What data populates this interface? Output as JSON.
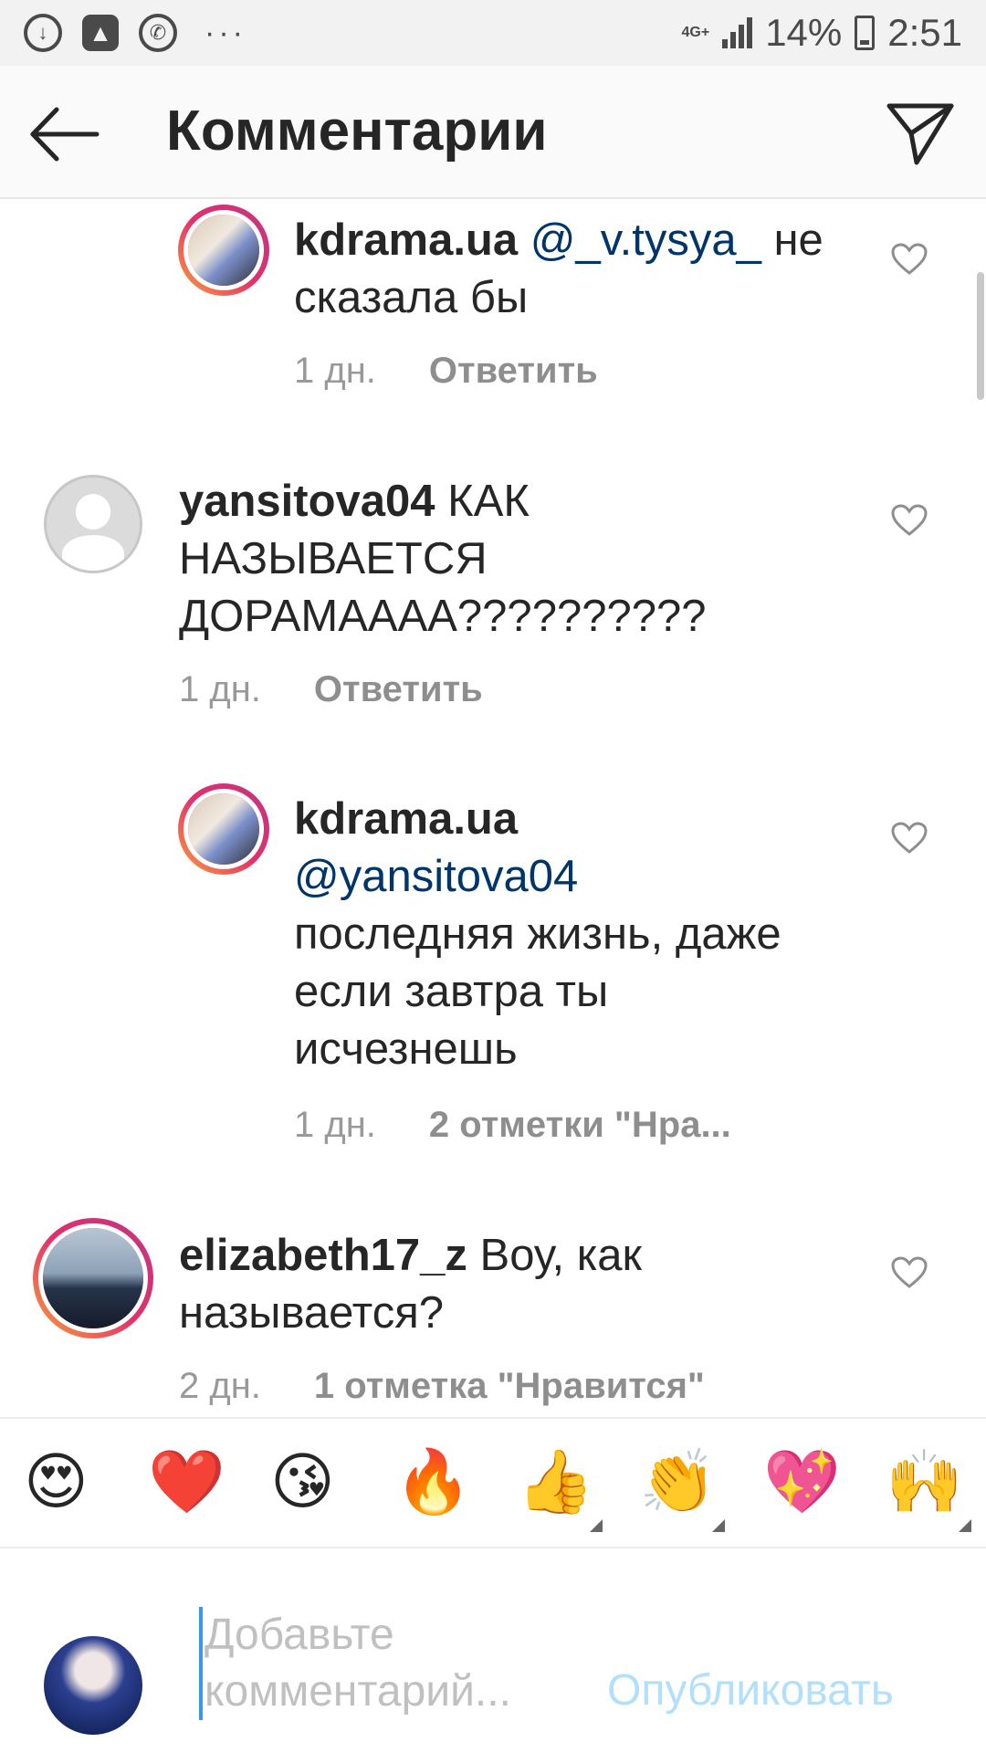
{
  "status_bar": {
    "left_icons": [
      "download-icon",
      "image-icon",
      "whatsapp-icon"
    ],
    "overflow": "···",
    "network": "4G+",
    "battery": "14%",
    "time": "2:51"
  },
  "header": {
    "title": "Комментарии",
    "back_icon": "back-arrow-icon",
    "send_icon": "paper-plane-icon"
  },
  "comments": [
    {
      "user": "kdrama.ua",
      "mention": "@_v.tysya_",
      "text": " не сказала бы",
      "time": "1 дн.",
      "action": "Ответить",
      "reply": true
    },
    {
      "user": "yansitova04",
      "text": " КАК НАЗЫВАЕТСЯ ДОРАМАААА??????????",
      "time": "1 дн.",
      "action": "Ответить",
      "reply": false
    },
    {
      "user": "kdrama.ua",
      "mention": "@yansitova04",
      "text": "последняя жизнь, даже если завтра ты исчезнешь",
      "time": "1 дн.",
      "action": "2 отметки \"Нра...",
      "reply": true
    },
    {
      "user": "elizabeth17_z",
      "text": " Воу, как называется?",
      "time": "2 дн.",
      "action": "1 отметка \"Нравится\"",
      "reply": false
    }
  ],
  "emojis": [
    "😍",
    "❤️",
    "😘",
    "🔥",
    "👍",
    "👏",
    "💖",
    "🙌"
  ],
  "composer": {
    "placeholder": "Добавьте комментарий...",
    "publish_label": "Опубликовать"
  },
  "colors": {
    "mention": "#003569",
    "publish_disabled": "#b2dffc",
    "cursor": "#3897f0"
  }
}
